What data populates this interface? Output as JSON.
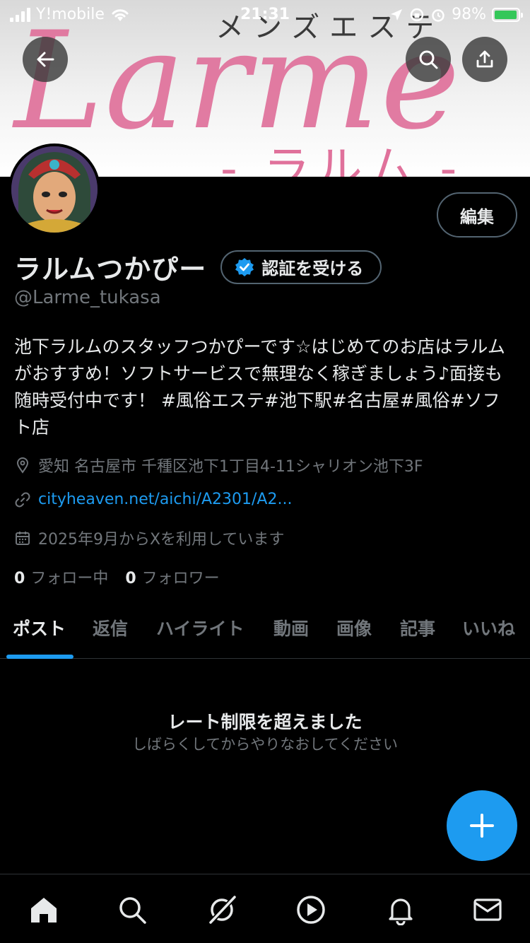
{
  "status_bar": {
    "carrier": "Y!mobile",
    "time": "21:31",
    "battery": "98%",
    "battery_level": 0.98
  },
  "banner": {
    "tagline": "メンズエステ",
    "logo": "Larme",
    "logo_sub": "- ラルム -"
  },
  "header": {
    "back_icon": "arrow-left-icon",
    "search_icon": "search-icon",
    "share_icon": "share-icon"
  },
  "profile": {
    "edit_label": "編集",
    "display_name": "ラルムつかぴー",
    "verify_label": "認証を受ける",
    "handle": "@Larme_tukasa",
    "bio": "池下ラルムのスタッフつかぴーです☆はじめてのお店はラルムがおすすめ！ソフトサービスで無理なく稼ぎましょう♪面接も随時受付中です！ #風俗エステ#池下駅#名古屋#風俗#ソフト店",
    "location": "愛知 名古屋市 千種区池下1丁目4-11シャリオン池下3F",
    "website": "cityheaven.net/aichi/A2301/A2...",
    "joined": "2025年9月からXを利用しています",
    "following_count": "0",
    "following_label": "フォロー中",
    "followers_count": "0",
    "followers_label": "フォロワー"
  },
  "tabs": [
    "ポスト",
    "返信",
    "ハイライト",
    "動画",
    "画像",
    "記事",
    "いいね"
  ],
  "active_tab": "ポスト",
  "empty_state": {
    "title": "レート制限を超えました",
    "subtitle": "しばらくしてからやりなおしてください"
  },
  "colors": {
    "accent": "#1d9bf0",
    "background": "#000000",
    "muted": "#71767b",
    "text": "#e7e9ea",
    "logo_pink": "#e0719b"
  },
  "bottom_nav": [
    "home-icon",
    "search-icon",
    "grok-icon",
    "video-icon",
    "bell-icon",
    "mail-icon"
  ]
}
